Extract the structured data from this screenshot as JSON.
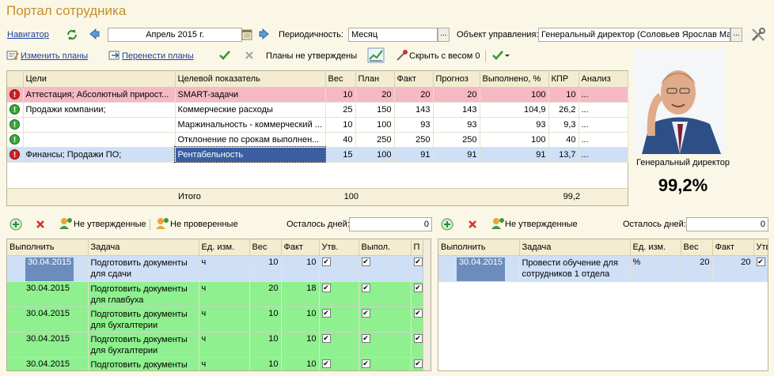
{
  "app": {
    "title": "Портал сотрудника"
  },
  "header": {
    "navigator_label": "Навигатор",
    "period_value": "Апрель 2015 г.",
    "periodicity_label": "Периодичность:",
    "periodicity_value": "Месяц",
    "object_label": "Объект управления:",
    "object_value": "Генеральный директор (Соловьев Ярослав Ма"
  },
  "toolbar": {
    "change_plans": "Изменить планы",
    "move_plans": "Перенести планы",
    "plans_status": "Планы не утверждены",
    "hide_weight": "Скрыть с весом 0"
  },
  "goals_table": {
    "columns": [
      "Цели",
      "Целевой показатель",
      "Вес",
      "План",
      "Факт",
      "Прогноз",
      "Выполнено, %",
      "КПР",
      "Анализ"
    ],
    "rows": [
      {
        "status": "red",
        "goal": "Аттестация; Абсолютный прирост...",
        "indicator": "SMART-задачи",
        "weight": "10",
        "plan": "20",
        "fact": "20",
        "forecast": "20",
        "done": "100",
        "kpr": "10",
        "analysis": "..."
      },
      {
        "status": "green",
        "goal": "Продажи компании;",
        "indicator": "Коммерческие расходы",
        "weight": "25",
        "plan": "150",
        "fact": "143",
        "forecast": "143",
        "done": "104,9",
        "kpr": "26,2",
        "analysis": "..."
      },
      {
        "status": "green",
        "goal": "",
        "indicator": "Маржинальность - коммерческий ...",
        "weight": "10",
        "plan": "100",
        "fact": "93",
        "forecast": "93",
        "done": "93",
        "kpr": "9,3",
        "analysis": "..."
      },
      {
        "status": "green",
        "goal": "",
        "indicator": "Отклонение по срокам выполнен...",
        "weight": "40",
        "plan": "250",
        "fact": "250",
        "forecast": "250",
        "done": "100",
        "kpr": "40",
        "analysis": "..."
      },
      {
        "status": "red",
        "goal": "Финансы; Продажи ПО;",
        "indicator": "Рентабельность",
        "weight": "15",
        "plan": "100",
        "fact": "91",
        "forecast": "91",
        "done": "91",
        "kpr": "13,7",
        "analysis": "..."
      }
    ],
    "total_label": "Итого",
    "total_weight": "100",
    "total_kpr": "99,2"
  },
  "profile": {
    "position": "Генеральный директор",
    "score": "99,2%"
  },
  "tasks_left": {
    "not_approved": "Не утвержденные",
    "not_checked": "Не проверенные",
    "days_left_label": "Осталось дней:",
    "days_left_value": "0",
    "columns": [
      "Выполнить",
      "Задача",
      "Ед. изм.",
      "Вес",
      "Факт",
      "Утв.",
      "Выпол.",
      "П"
    ],
    "rows": [
      {
        "date": "30.04.2015",
        "task": "Подготовить документы для сдачи",
        "unit": "ч",
        "weight": "10",
        "fact": "10"
      },
      {
        "date": "30.04.2015",
        "task": "Подготовить документы для главбуха",
        "unit": "ч",
        "weight": "20",
        "fact": "18"
      },
      {
        "date": "30.04.2015",
        "task": "Подготовить документы для бухгалтерии",
        "unit": "ч",
        "weight": "10",
        "fact": "10"
      },
      {
        "date": "30.04.2015",
        "task": "Подготовить документы для бухгалтерии",
        "unit": "ч",
        "weight": "10",
        "fact": "10"
      },
      {
        "date": "30.04.2015",
        "task": "Подготовить документы",
        "unit": "ч",
        "weight": "10",
        "fact": "10"
      }
    ]
  },
  "tasks_right": {
    "not_approved": "Не утвержденные",
    "days_left_label": "Осталось дней:",
    "days_left_value": "0",
    "columns": [
      "Выполнить",
      "Задача",
      "Ед. изм.",
      "Вес",
      "Факт",
      "Утв"
    ],
    "rows": [
      {
        "date": "30.04.2015",
        "task": "Провести обучение для сотрудников 1 отдела",
        "unit": "%",
        "weight": "20",
        "fact": "20"
      }
    ]
  }
}
